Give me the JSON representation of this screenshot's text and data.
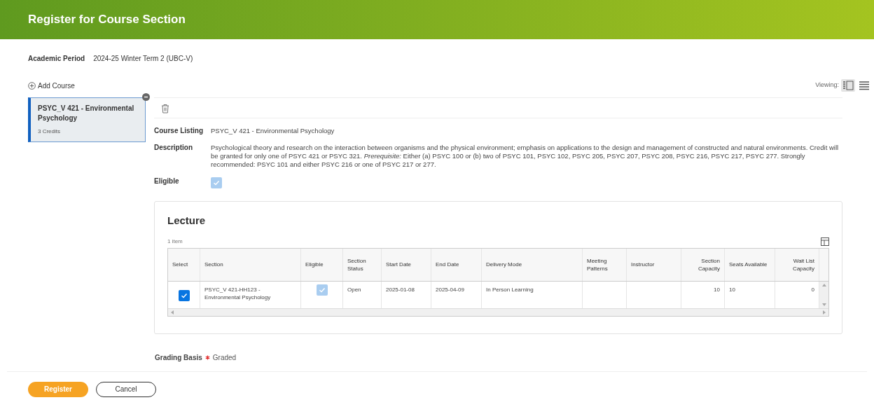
{
  "header": {
    "title": "Register for Course Section"
  },
  "academic_period": {
    "label": "Academic Period",
    "value": "2024-25 Winter Term 2 (UBC-V)"
  },
  "add_course": {
    "label": "Add Course"
  },
  "viewing": {
    "label": "Viewing:",
    "views": [
      {
        "kind": "detail",
        "selected": true
      },
      {
        "kind": "list",
        "selected": false
      }
    ]
  },
  "courses": [
    {
      "title": "PSYC_V 421 - Environmental Psychology",
      "credits": "3 Credits",
      "selected": true
    }
  ],
  "details": [
    {
      "kind": "text",
      "label": "Course Listing",
      "value": "PSYC_V 421 - Environmental Psychology"
    },
    {
      "kind": "text",
      "label": "Description",
      "value": "Psychological theory and research on the interaction between organisms and the physical environment; emphasis on applications to the design and management of constructed and natural environments.  Credit will be granted for only one of PSYC 421 or PSYC 321. *Prerequisite:* Either (a) PSYC 100 or (b) two of PSYC 101, PSYC 102, PSYC 205, PSYC 207, PSYC 208, PSYC 216, PSYC 217, PSYC 277. Strongly recommended: PSYC 101 and either PSYC 216 or one of PSYC 217 or 277."
    },
    {
      "kind": "check",
      "label": "Eligible",
      "checked": true
    }
  ],
  "lecture": {
    "title": "Lecture",
    "count": "1 item",
    "columns": [
      "Select",
      "Section",
      "Eligible",
      "Section Status",
      "Start Date",
      "End Date",
      "Delivery Mode",
      "Meeting Patterns",
      "Instructor",
      "Section Capacity",
      "Seats Available",
      "Wait List Capacity"
    ],
    "rows": [
      {
        "selected": true,
        "section": "PSYC_V 421-HH123 - Environmental Psychology",
        "eligible": true,
        "status": "Open",
        "start": "2025-01-08",
        "end": "2025-04-09",
        "delivery": "In Person Learning",
        "capacity": "10",
        "seats": "10",
        "waitlist": "0"
      }
    ]
  },
  "grading_basis": {
    "label": "Grading Basis",
    "required": true,
    "value": "Graded"
  },
  "buttons": [
    {
      "kind": "primary",
      "label": "Register"
    },
    {
      "kind": "secondary",
      "label": "Cancel"
    }
  ]
}
